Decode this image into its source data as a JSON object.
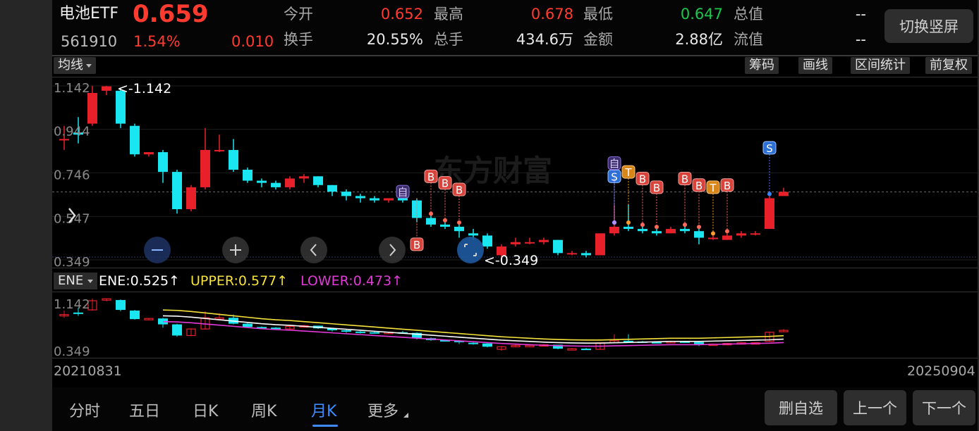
{
  "header": {
    "name": "电池ETF",
    "price": "0.659",
    "code": "561910",
    "change_pct": "1.54%",
    "change": "0.010",
    "rotate_button": "切换竖屏",
    "stats": {
      "open_label": "今开",
      "open": "0.652",
      "high_label": "最高",
      "high": "0.678",
      "low_label": "最低",
      "low": "0.647",
      "total_label": "总值",
      "total": "--",
      "turnover_label": "换手",
      "turnover": "20.55%",
      "volume_label": "总手",
      "volume": "434.6万",
      "amount_label": "金额",
      "amount": "2.88亿",
      "float_label": "流值",
      "float": "--"
    }
  },
  "toolbar": {
    "ma_label": "均线",
    "chips_label": "筹码",
    "draw_label": "画线",
    "interval_label": "区间统计",
    "adjust_label": "前复权"
  },
  "watermark": "东方财富",
  "chart_data": [
    {
      "type": "candlestick",
      "period": "monthly",
      "y_ticks": [
        "1.142",
        "0.944",
        "0.746",
        "0.547",
        "0.349"
      ],
      "ylim": [
        0.349,
        1.142
      ],
      "max_annotation": "<-1.142",
      "min_annotation": "<-0.349",
      "candles": [
        {
          "o": 0.9,
          "c": 0.9,
          "h": 0.96,
          "l": 0.85
        },
        {
          "o": 0.93,
          "c": 0.92,
          "h": 1.0,
          "l": 0.88
        },
        {
          "o": 0.97,
          "c": 1.11,
          "h": 1.142,
          "l": 0.96
        },
        {
          "o": 1.12,
          "c": 1.14,
          "h": 1.142,
          "l": 1.1
        },
        {
          "o": 1.12,
          "c": 0.97,
          "h": 1.13,
          "l": 0.95
        },
        {
          "o": 0.96,
          "c": 0.83,
          "h": 0.97,
          "l": 0.82
        },
        {
          "o": 0.83,
          "c": 0.84,
          "h": 0.84,
          "l": 0.82
        },
        {
          "o": 0.84,
          "c": 0.75,
          "h": 0.85,
          "l": 0.7
        },
        {
          "o": 0.75,
          "c": 0.58,
          "h": 0.76,
          "l": 0.56
        },
        {
          "o": 0.58,
          "c": 0.68,
          "h": 0.69,
          "l": 0.57
        },
        {
          "o": 0.68,
          "c": 0.85,
          "h": 0.95,
          "l": 0.67
        },
        {
          "o": 0.85,
          "c": 0.85,
          "h": 0.92,
          "l": 0.84
        },
        {
          "o": 0.85,
          "c": 0.76,
          "h": 0.9,
          "l": 0.75
        },
        {
          "o": 0.76,
          "c": 0.71,
          "h": 0.77,
          "l": 0.7
        },
        {
          "o": 0.71,
          "c": 0.7,
          "h": 0.72,
          "l": 0.68
        },
        {
          "o": 0.7,
          "c": 0.68,
          "h": 0.71,
          "l": 0.67
        },
        {
          "o": 0.68,
          "c": 0.72,
          "h": 0.73,
          "l": 0.67
        },
        {
          "o": 0.72,
          "c": 0.73,
          "h": 0.74,
          "l": 0.7
        },
        {
          "o": 0.73,
          "c": 0.69,
          "h": 0.73,
          "l": 0.68
        },
        {
          "o": 0.69,
          "c": 0.66,
          "h": 0.69,
          "l": 0.64
        },
        {
          "o": 0.66,
          "c": 0.64,
          "h": 0.67,
          "l": 0.62
        },
        {
          "o": 0.64,
          "c": 0.63,
          "h": 0.65,
          "l": 0.61
        },
        {
          "o": 0.63,
          "c": 0.62,
          "h": 0.64,
          "l": 0.61
        },
        {
          "o": 0.62,
          "c": 0.63,
          "h": 0.63,
          "l": 0.61
        },
        {
          "o": 0.63,
          "c": 0.62,
          "h": 0.65,
          "l": 0.61
        },
        {
          "o": 0.62,
          "c": 0.54,
          "h": 0.63,
          "l": 0.52
        },
        {
          "o": 0.54,
          "c": 0.51,
          "h": 0.55,
          "l": 0.5
        },
        {
          "o": 0.51,
          "c": 0.5,
          "h": 0.52,
          "l": 0.49
        },
        {
          "o": 0.5,
          "c": 0.48,
          "h": 0.51,
          "l": 0.45
        },
        {
          "o": 0.47,
          "c": 0.46,
          "h": 0.49,
          "l": 0.44
        },
        {
          "o": 0.46,
          "c": 0.41,
          "h": 0.47,
          "l": 0.4
        },
        {
          "o": 0.37,
          "c": 0.41,
          "h": 0.42,
          "l": 0.349
        },
        {
          "o": 0.42,
          "c": 0.43,
          "h": 0.45,
          "l": 0.41
        },
        {
          "o": 0.43,
          "c": 0.43,
          "h": 0.45,
          "l": 0.42
        },
        {
          "o": 0.43,
          "c": 0.44,
          "h": 0.45,
          "l": 0.42
        },
        {
          "o": 0.44,
          "c": 0.38,
          "h": 0.44,
          "l": 0.37
        },
        {
          "o": 0.38,
          "c": 0.38,
          "h": 0.39,
          "l": 0.37
        },
        {
          "o": 0.38,
          "c": 0.37,
          "h": 0.39,
          "l": 0.36
        },
        {
          "o": 0.37,
          "c": 0.47,
          "h": 0.47,
          "l": 0.37
        },
        {
          "o": 0.47,
          "c": 0.5,
          "h": 0.6,
          "l": 0.46
        },
        {
          "o": 0.5,
          "c": 0.49,
          "h": 0.6,
          "l": 0.48
        },
        {
          "o": 0.49,
          "c": 0.48,
          "h": 0.5,
          "l": 0.47
        },
        {
          "o": 0.48,
          "c": 0.47,
          "h": 0.49,
          "l": 0.46
        },
        {
          "o": 0.47,
          "c": 0.49,
          "h": 0.5,
          "l": 0.47
        },
        {
          "o": 0.49,
          "c": 0.48,
          "h": 0.5,
          "l": 0.47
        },
        {
          "o": 0.48,
          "c": 0.45,
          "h": 0.49,
          "l": 0.42
        },
        {
          "o": 0.45,
          "c": 0.45,
          "h": 0.46,
          "l": 0.44
        },
        {
          "o": 0.44,
          "c": 0.46,
          "h": 0.47,
          "l": 0.44
        },
        {
          "o": 0.46,
          "c": 0.47,
          "h": 0.48,
          "l": 0.45
        },
        {
          "o": 0.47,
          "c": 0.47,
          "h": 0.48,
          "l": 0.46
        },
        {
          "o": 0.49,
          "c": 0.63,
          "h": 0.64,
          "l": 0.49
        },
        {
          "o": 0.64,
          "c": 0.659,
          "h": 0.678,
          "l": 0.647
        }
      ],
      "signals": [
        {
          "i": 24,
          "label": "自",
          "kind": "zi",
          "at": 0.66
        },
        {
          "i": 25,
          "label": "B",
          "kind": "b",
          "at": 0.42,
          "low": true
        },
        {
          "i": 26,
          "label": "B",
          "kind": "b",
          "at": 0.73
        },
        {
          "i": 27,
          "label": "B",
          "kind": "b",
          "at": 0.7
        },
        {
          "i": 28,
          "label": "B",
          "kind": "b",
          "at": 0.67
        },
        {
          "i": 39,
          "label": "S",
          "kind": "s",
          "at": 0.73
        },
        {
          "i": 39,
          "label": "自",
          "kind": "zi",
          "at": 0.79
        },
        {
          "i": 40,
          "label": "T",
          "kind": "t",
          "at": 0.75
        },
        {
          "i": 41,
          "label": "B",
          "kind": "b",
          "at": 0.72
        },
        {
          "i": 42,
          "label": "B",
          "kind": "b",
          "at": 0.68
        },
        {
          "i": 44,
          "label": "B",
          "kind": "b",
          "at": 0.72
        },
        {
          "i": 45,
          "label": "B",
          "kind": "b",
          "at": 0.69
        },
        {
          "i": 46,
          "label": "T",
          "kind": "t",
          "at": 0.68
        },
        {
          "i": 47,
          "label": "B",
          "kind": "b",
          "at": 0.69
        },
        {
          "i": 50,
          "label": "S",
          "kind": "s",
          "at": 0.86
        }
      ]
    },
    {
      "type": "line",
      "indicator": "ENE",
      "y_ticks": [
        "1.142",
        "0.349"
      ],
      "series": [
        {
          "name": "ENE",
          "value": "0.525",
          "color": "#ffffff"
        },
        {
          "name": "UPPER",
          "value": "0.577",
          "color": "#f5e23b"
        },
        {
          "name": "LOWER",
          "value": "0.473",
          "color": "#e13ad6"
        }
      ],
      "ene_values": [
        0.88,
        0.875,
        0.86,
        0.84,
        0.82,
        0.8,
        0.78,
        0.76,
        0.745,
        0.735,
        0.72,
        0.705,
        0.69,
        0.675,
        0.66,
        0.645,
        0.63,
        0.615,
        0.6,
        0.585,
        0.57,
        0.555,
        0.54,
        0.525,
        0.51,
        0.5,
        0.49,
        0.48,
        0.473,
        0.468,
        0.465,
        0.465,
        0.47,
        0.475,
        0.48,
        0.485,
        0.49,
        0.49,
        0.49,
        0.495,
        0.5,
        0.505,
        0.51,
        0.515,
        0.525
      ]
    }
  ],
  "date_start": "20210831",
  "date_end": "20250904",
  "tabs": [
    "分时",
    "五日",
    "日K",
    "周K",
    "月K",
    "更多"
  ],
  "buttons": {
    "remove": "删自选",
    "prev": "上一个",
    "next": "下一个"
  }
}
